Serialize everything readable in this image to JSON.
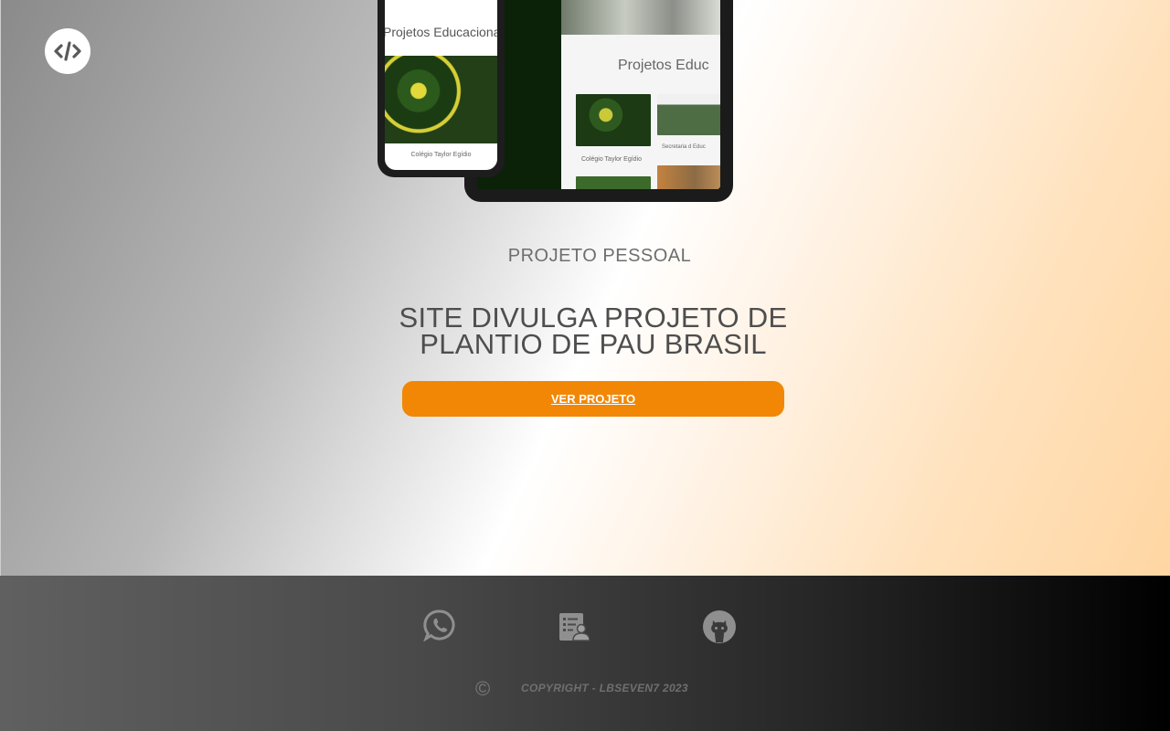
{
  "mockup": {
    "phone_title": "Projetos Educacionais",
    "phone_caption": "Colégio Taylor Egídio",
    "tablet_title": "Projetos Educ",
    "tablet_caption_1": "Colégio Taylor Egídio",
    "tablet_caption_2": "Secretaria d Educ"
  },
  "project": {
    "kicker": "PROJETO PESSOAL",
    "headline_line1": "SITE DIVULGA PROJETO DE",
    "headline_line2": "PLANTIO DE PAU BRASIL",
    "cta_label": "VER PROJETO"
  },
  "footer": {
    "copyright_symbol": "©",
    "copyright_text": "COPYRIGHT - LBSEVEN7 2023"
  },
  "icons": {
    "logo": "code-icon",
    "whatsapp": "whatsapp-icon",
    "resume": "resume-icon",
    "github": "github-icon"
  },
  "colors": {
    "accent": "#f28705",
    "footer_icon": "#8f8f8f"
  }
}
